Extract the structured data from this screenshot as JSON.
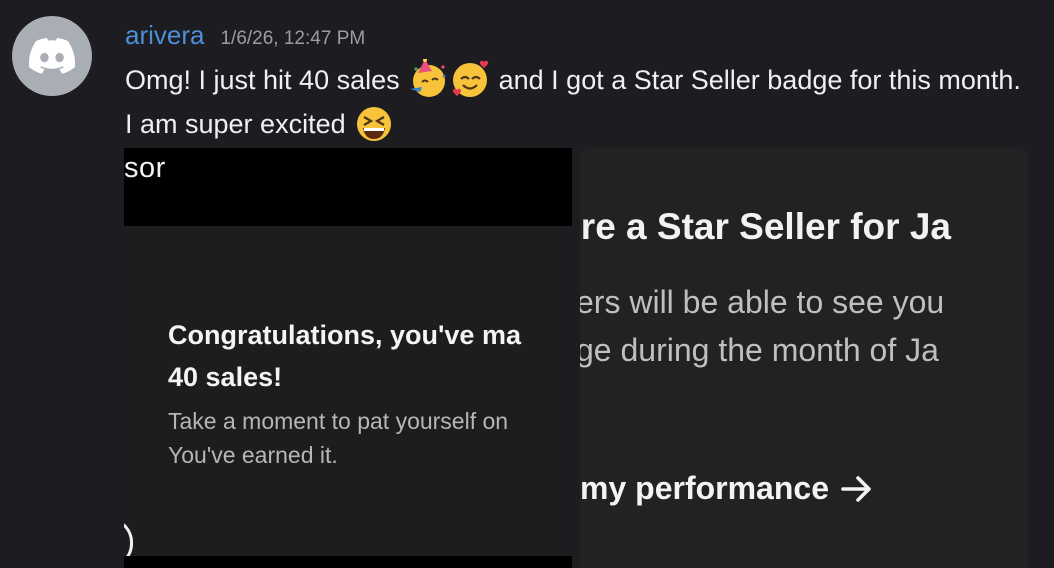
{
  "message": {
    "username": "arivera",
    "timestamp": "1/6/26, 12:47 PM",
    "text_part1": "Omg! I just hit 40 sales ",
    "text_part2": " and I got a Star Seller badge for this month. I am super excited ",
    "emojis": [
      "partying-face-emoji",
      "smiling-face-with-hearts-emoji",
      "grinning-squinting-face-emoji"
    ]
  },
  "attachments": [
    {
      "top_text": "sor",
      "title_line1": "Congratulations, you've ma",
      "title_line2": "40 sales!",
      "subtitle_line1": "Take a moment to pat yourself on",
      "subtitle_line2": "You've earned it."
    },
    {
      "title": "'re a Star Seller for Ja",
      "body_line1": "ers will be able to see you",
      "body_line2": "ge during the month of Ja",
      "link_label": "my performance"
    }
  ],
  "colors": {
    "background": "#1c1c21",
    "username": "#4e8fd6",
    "timestamp": "#9a9da5",
    "avatar_bg": "#a9adb4"
  }
}
